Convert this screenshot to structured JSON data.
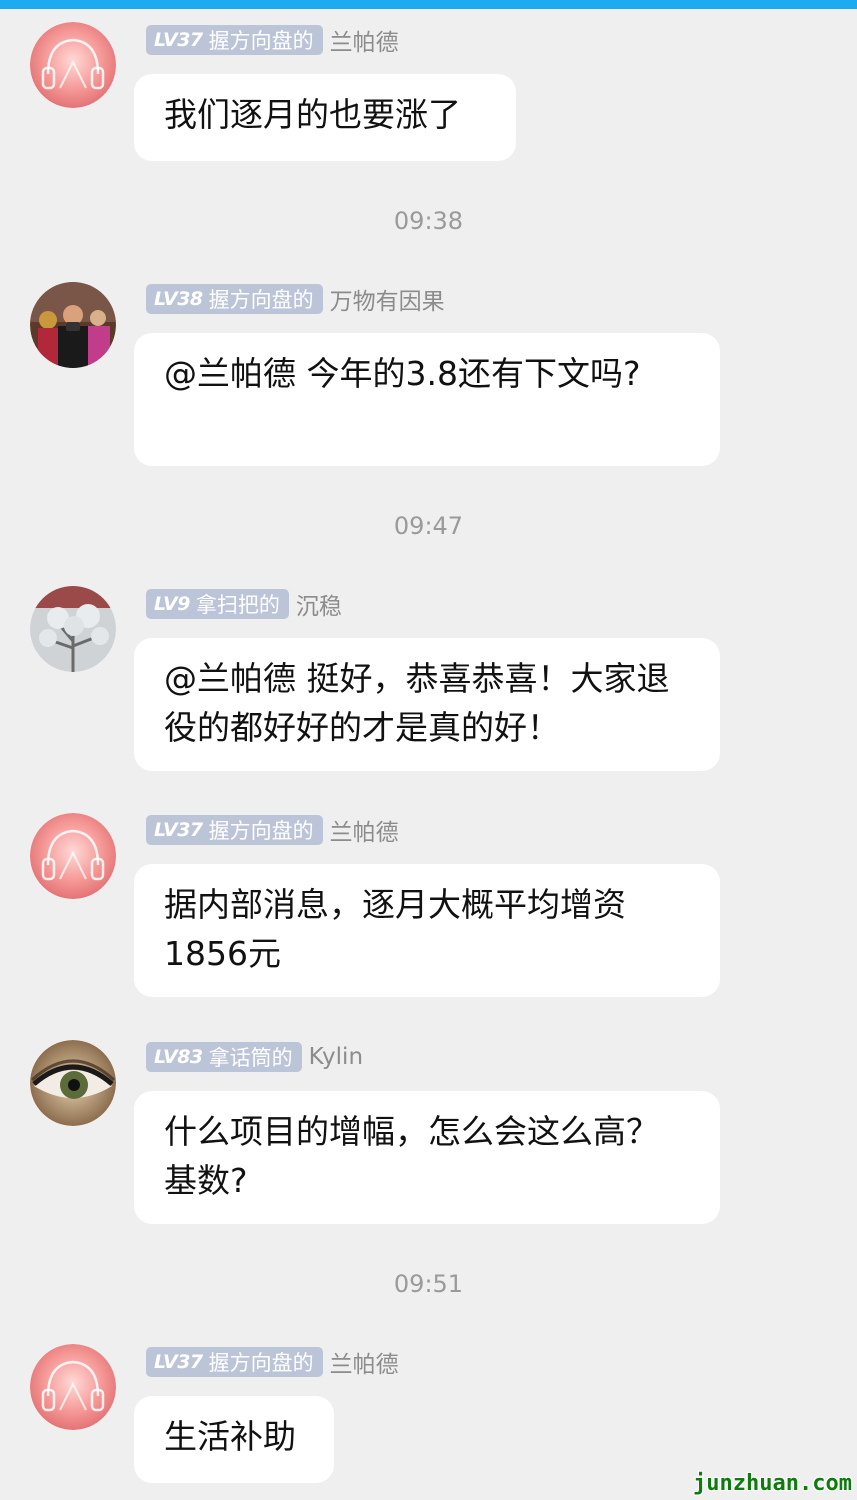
{
  "colors": {
    "top_bar": "#1eaaf1",
    "badge_bg": "#bcc4d8",
    "watermark": "#0e7a10"
  },
  "messages": [
    {
      "level": "LV37",
      "title": "握方向盘的",
      "username": "兰帕德",
      "avatar": "pink-headphones-avatar",
      "text": "我们逐月的也要涨了"
    },
    {
      "level": "LV38",
      "title": "握方向盘的",
      "username": "万物有因果",
      "avatar": "photographer-photo-avatar",
      "text": "@兰帕德 今年的3.8还有下文吗?"
    },
    {
      "level": "LV9",
      "title": "拿扫把的",
      "username": "沉稳",
      "avatar": "frosted-tree-avatar",
      "text": "@兰帕德 挺好，恭喜恭喜！大家退役的都好好的才是真的好！"
    },
    {
      "level": "LV37",
      "title": "握方向盘的",
      "username": "兰帕德",
      "avatar": "pink-headphones-avatar",
      "text": "据内部消息，逐月大概平均增资1856元"
    },
    {
      "level": "LV83",
      "title": "拿话筒的",
      "username": "Kylin",
      "avatar": "eye-makeup-avatar",
      "text": "什么项目的增幅，怎么会这么高？基数?"
    },
    {
      "level": "LV37",
      "title": "握方向盘的",
      "username": "兰帕德",
      "avatar": "pink-headphones-avatar",
      "text": "生活补助"
    }
  ],
  "timestamps": [
    "09:38",
    "09:47",
    "09:51"
  ],
  "watermark": "junzhuan.com"
}
